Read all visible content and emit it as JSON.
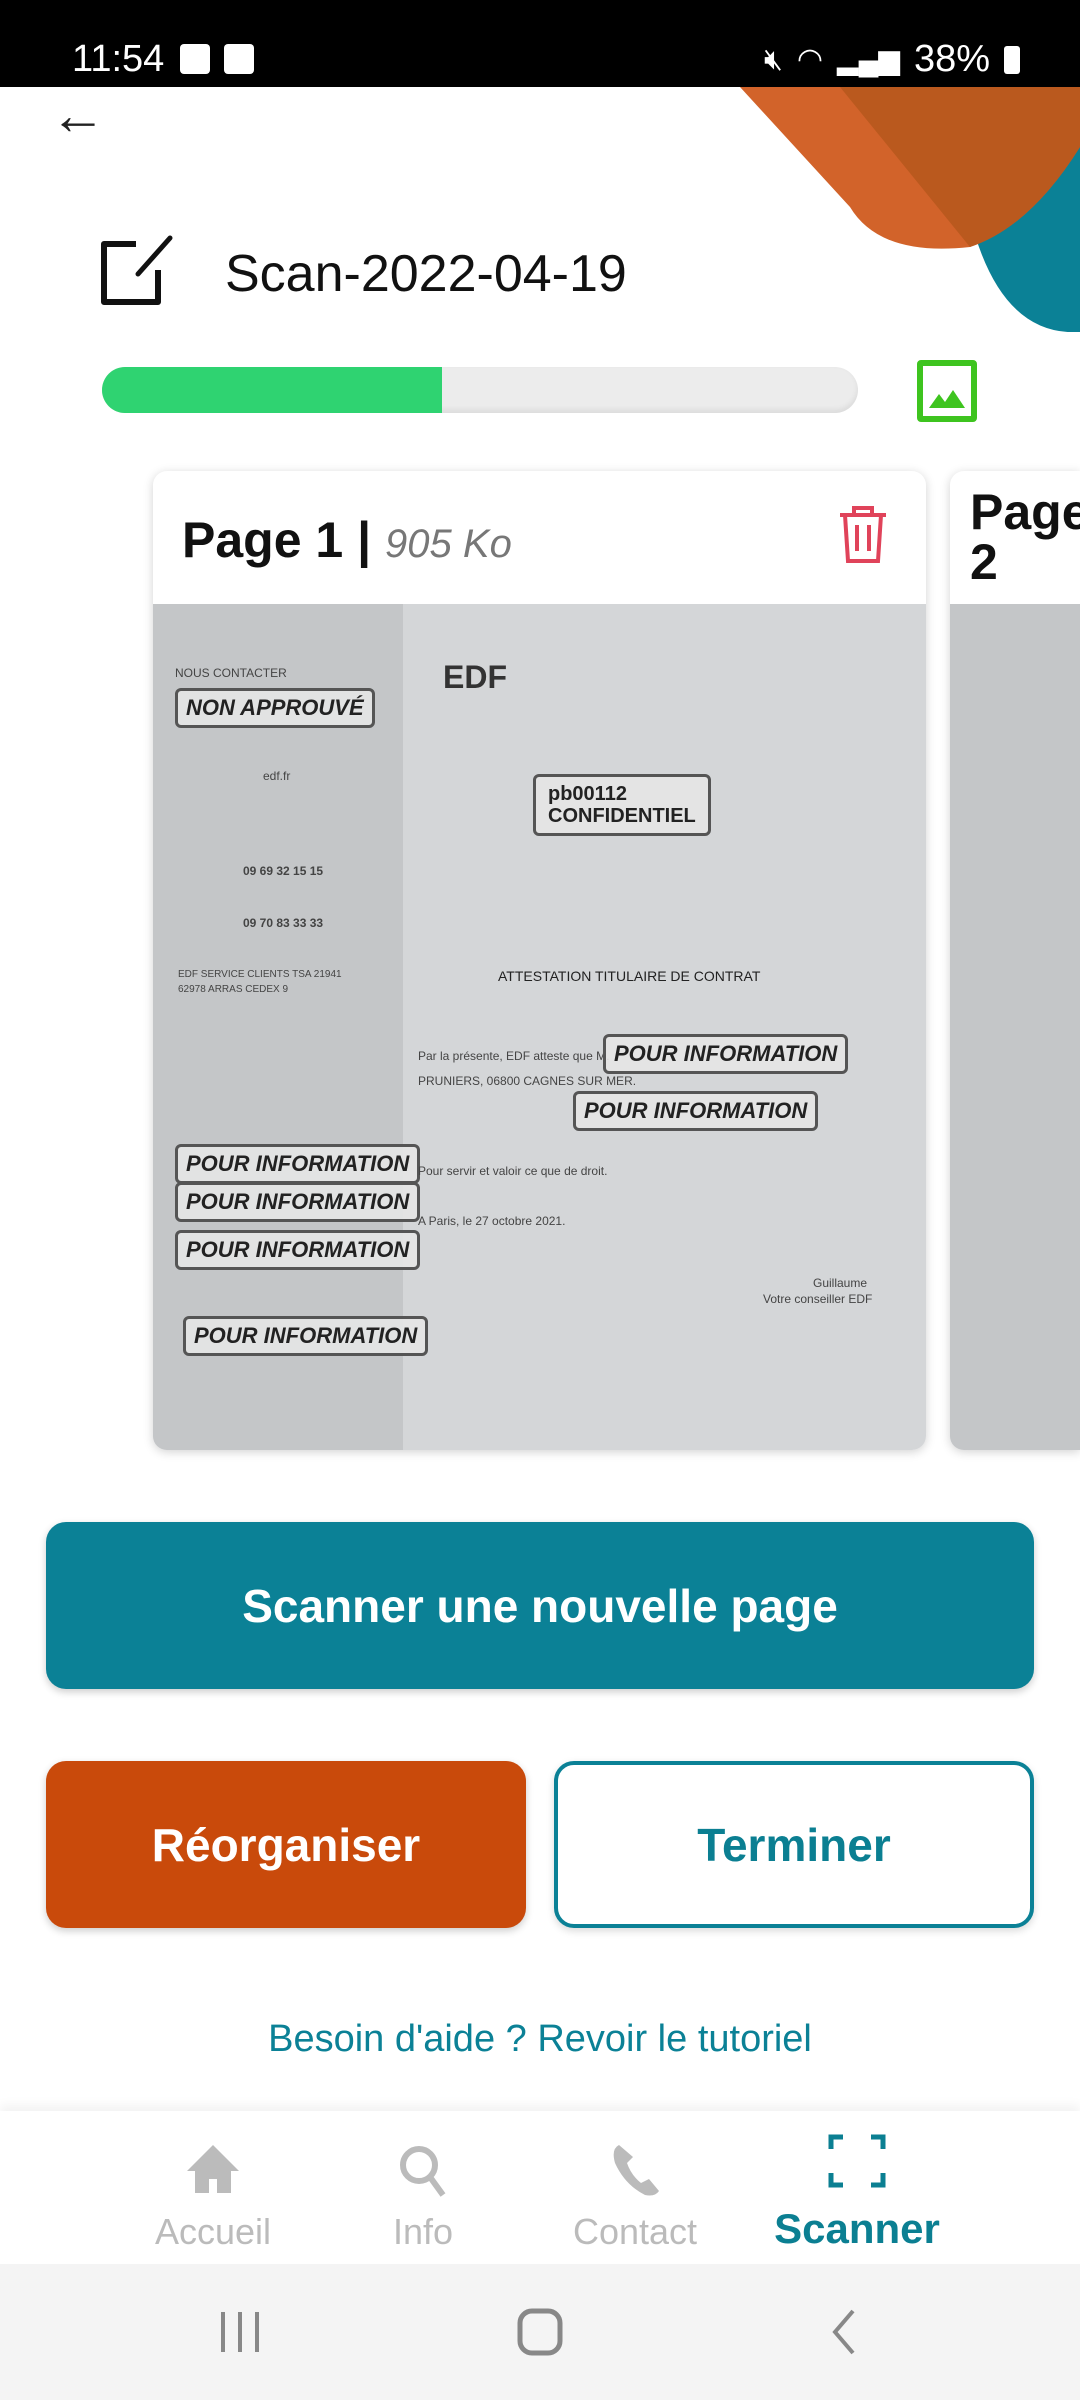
{
  "status_bar": {
    "time": "11:54",
    "battery": "38%"
  },
  "header": {
    "title": "Scan-2022-04-19",
    "progress_percent": 45
  },
  "pages": [
    {
      "label": "Page 1",
      "size": "905 Ko",
      "separator": "|"
    },
    {
      "label": "Page 2"
    }
  ],
  "document_preview": {
    "logo": "EDF",
    "stamp_top": "NON APPROUVÉ",
    "stamp_conf_1": "pb00112",
    "stamp_conf_2": "CONFIDENTIEL",
    "heading": "ATTESTATION TITULAIRE DE CONTRAT",
    "stamp_info": "POUR INFORMATION",
    "contact_header": "NOUS CONTACTER",
    "site": "edf.fr",
    "phone1": "09 69 32 15 15",
    "phone2": "09 70 83 33 33",
    "address": "EDF SERVICE CLIENTS TSA 21941",
    "city": "62978 ARRAS CEDEX 9",
    "body1": "Par la présente, EDF atteste que M.",
    "body2": "PRUNIERS, 06800 CAGNES SUR MER.",
    "body3": "Pour servir et valoir ce que de droit.",
    "date": "A Paris, le 27 octobre 2021.",
    "signature": "Guillaume",
    "signature_role": "Votre conseiller EDF"
  },
  "actions": {
    "scan_new": "Scanner une nouvelle page",
    "reorganize": "Réorganiser",
    "finish": "Terminer",
    "help": "Besoin d'aide ? Revoir le tutoriel"
  },
  "bottom_nav": [
    {
      "label": "Accueil",
      "icon": "home-icon"
    },
    {
      "label": "Info",
      "icon": "search-icon"
    },
    {
      "label": "Contact",
      "icon": "phone-icon"
    },
    {
      "label": "Scanner",
      "icon": "scan-icon",
      "active": true
    }
  ],
  "colors": {
    "primary": "#0b8196",
    "accent": "#c94a0b",
    "progress": "#2fd371"
  }
}
